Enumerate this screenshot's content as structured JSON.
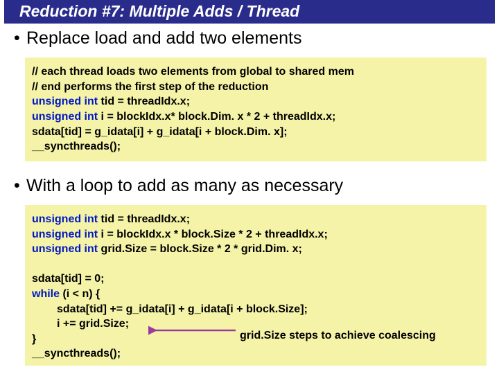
{
  "title": "Reduction #7: Multiple Adds / Thread",
  "bullet1": "Replace load and add two elements",
  "bullet2": "With a loop to add as many as necessary",
  "code1": {
    "c1": "// each thread loads two elements from global to shared mem",
    "c2": "// end performs the first step of the reduction",
    "l1a": "unsigned int ",
    "l1b": "tid = threadIdx.x;",
    "l2a": "unsigned int ",
    "l2b": "i = blockIdx.x* block.Dim. x * 2 + threadIdx.x;",
    "l3": "sdata[tid] = g_idata[i] + g_idata[i + block.Dim. x];",
    "l4": "__syncthreads();"
  },
  "code2": {
    "l1a": "unsigned int ",
    "l1b": "tid = threadIdx.x;",
    "l2a": "unsigned int ",
    "l2b": "i = blockIdx.x * block.Size * 2 + threadIdx.x;",
    "l3a": "unsigned int ",
    "l3b": "grid.Size = block.Size * 2 * grid.Dim. x;",
    "blank": " ",
    "l4": "sdata[tid] = 0;",
    "l5a": "while ",
    "l5b": "(i < n) {",
    "l6": "sdata[tid] += g_idata[i] + g_idata[i + block.Size];",
    "l7": "i += grid.Size;",
    "l8": "}",
    "l9": "__syncthreads();"
  },
  "annotation": "grid.Size steps to achieve coalescing"
}
